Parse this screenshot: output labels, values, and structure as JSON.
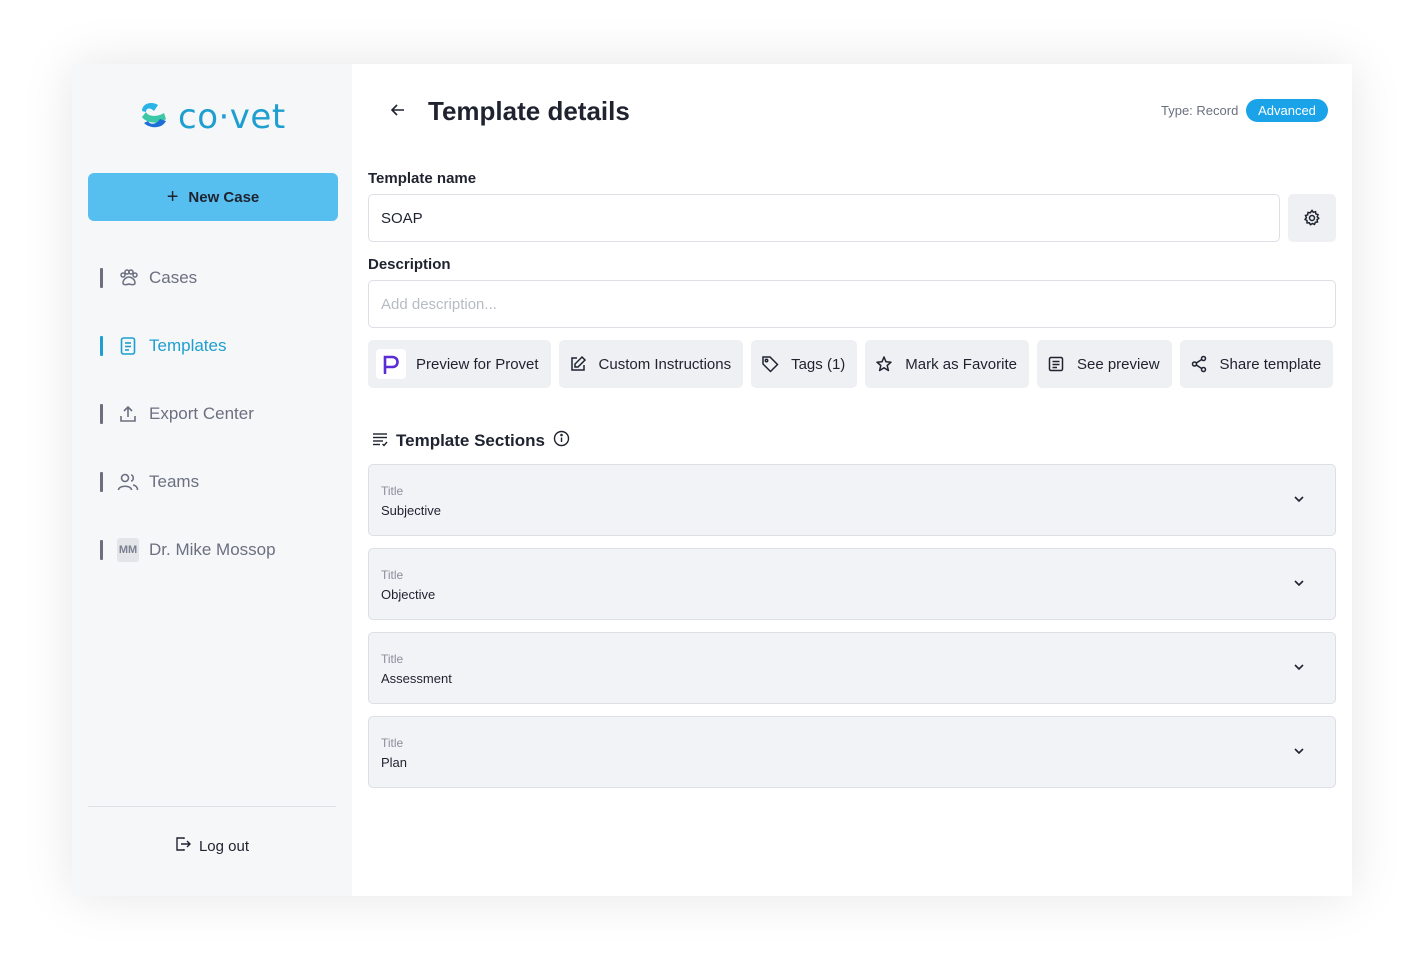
{
  "sidebar": {
    "logo_text": "co·vet",
    "new_case_label": "New Case",
    "items": [
      {
        "label": "Cases",
        "icon": "paw-icon",
        "active": false
      },
      {
        "label": "Templates",
        "icon": "document-icon",
        "active": true
      },
      {
        "label": "Export Center",
        "icon": "upload-icon",
        "active": false
      },
      {
        "label": "Teams",
        "icon": "users-icon",
        "active": false
      },
      {
        "label": "Dr. Mike Mossop",
        "icon": "avatar-initials",
        "initials": "MM",
        "active": false
      }
    ],
    "logout_label": "Log out"
  },
  "header": {
    "title": "Template details",
    "type_label": "Type: Record",
    "badge": "Advanced"
  },
  "form": {
    "name_label": "Template name",
    "name_value": "SOAP",
    "description_label": "Description",
    "description_placeholder": "Add description..."
  },
  "actions": [
    {
      "label": "Preview for Provet",
      "icon": "provet-logo-icon"
    },
    {
      "label": "Custom Instructions",
      "icon": "edit-icon"
    },
    {
      "label": "Tags (1)",
      "icon": "tag-icon"
    },
    {
      "label": "Mark as Favorite",
      "icon": "star-icon"
    },
    {
      "label": "See preview",
      "icon": "preview-icon"
    },
    {
      "label": "Share template",
      "icon": "share-icon"
    }
  ],
  "sections": {
    "heading": "Template Sections",
    "items": [
      {
        "title_label": "Title",
        "value": "Subjective"
      },
      {
        "title_label": "Title",
        "value": "Objective"
      },
      {
        "title_label": "Title",
        "value": "Assessment"
      },
      {
        "title_label": "Title",
        "value": "Plan"
      }
    ]
  },
  "colors": {
    "accent": "#1e9fd0",
    "new_case_bg": "#57bff0",
    "badge_bg": "#1aa3e8",
    "provet_purple": "#5b2bd6"
  }
}
